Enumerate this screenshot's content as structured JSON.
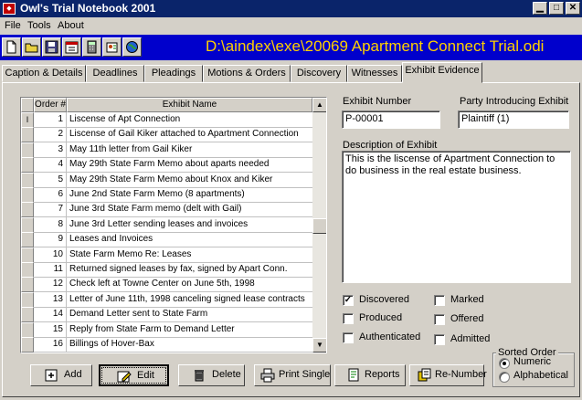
{
  "window": {
    "title": "Owl's Trial Notebook 2001",
    "app_icon": "owl-app-icon"
  },
  "menu": [
    "File",
    "Tools",
    "About"
  ],
  "toolbar": {
    "file_path": "D:\\aindex\\exe\\20069 Apartment Connect Trial.odi"
  },
  "tabs": [
    "Caption & Details",
    "Deadlines",
    "Pleadings",
    "Motions & Orders",
    "Discovery",
    "Witnesses",
    "Exhibit Evidence"
  ],
  "active_tab": "Exhibit Evidence",
  "grid": {
    "columns": [
      "Order #",
      "Exhibit Name"
    ],
    "current_row_marker": "I",
    "rows": [
      {
        "order": "1",
        "name": "Liscense of Apt Connection"
      },
      {
        "order": "2",
        "name": "Liscense of Gail Kiker attached to Apartment Connection"
      },
      {
        "order": "3",
        "name": "May 11th letter from Gail Kiker"
      },
      {
        "order": "4",
        "name": "May 29th State Farm Memo about aparts needed"
      },
      {
        "order": "5",
        "name": "May 29th State Farm Memo about Knox and Kiker"
      },
      {
        "order": "6",
        "name": "June 2nd State Farm Memo (8 apartments)"
      },
      {
        "order": "7",
        "name": "June 3rd State Farm memo (delt with Gail)"
      },
      {
        "order": "8",
        "name": "June 3rd Letter sending leases and invoices"
      },
      {
        "order": "9",
        "name": "Leases and Invoices"
      },
      {
        "order": "10",
        "name": "State Farm Memo Re: Leases"
      },
      {
        "order": "11",
        "name": "Returned signed leases by fax, signed by Apart Conn."
      },
      {
        "order": "12",
        "name": "Check left at Towne Center on June 5th, 1998"
      },
      {
        "order": "13",
        "name": "Letter of June 11th, 1998 canceling signed lease contracts"
      },
      {
        "order": "14",
        "name": "Demand Letter sent to State Farm"
      },
      {
        "order": "15",
        "name": "Reply from State Farm to Demand Letter"
      },
      {
        "order": "16",
        "name": "Billings of Hover-Bax"
      }
    ]
  },
  "detail": {
    "exhibit_number_label": "Exhibit Number",
    "exhibit_number": "P-00001",
    "party_label": "Party Introducing Exhibit",
    "party": "Plaintiff (1)",
    "description_label": "Description of Exhibit",
    "description": "This is the liscense of Apartment Connection to do business in the real estate business.",
    "checks": {
      "discovered": {
        "label": "Discovered",
        "checked": true
      },
      "marked": {
        "label": "Marked",
        "checked": false
      },
      "produced": {
        "label": "Produced",
        "checked": false
      },
      "offered": {
        "label": "Offered",
        "checked": false
      },
      "authenticated": {
        "label": "Authenticated",
        "checked": false
      },
      "admitted": {
        "label": "Admitted",
        "checked": false
      }
    },
    "sort": {
      "title": "Sorted Order",
      "numeric": "Numeric",
      "alphabetical": "Alphabetical",
      "selected": "Numeric"
    }
  },
  "buttons": {
    "add": "Add",
    "edit": "Edit",
    "delete": "Delete",
    "print_single": "Print Single",
    "reports": "Reports",
    "renumber": "Re-Number"
  },
  "colors": {
    "toolbar_bg": "#0000cc",
    "path_text": "#ffd000",
    "titlebar": "#0a246a"
  }
}
